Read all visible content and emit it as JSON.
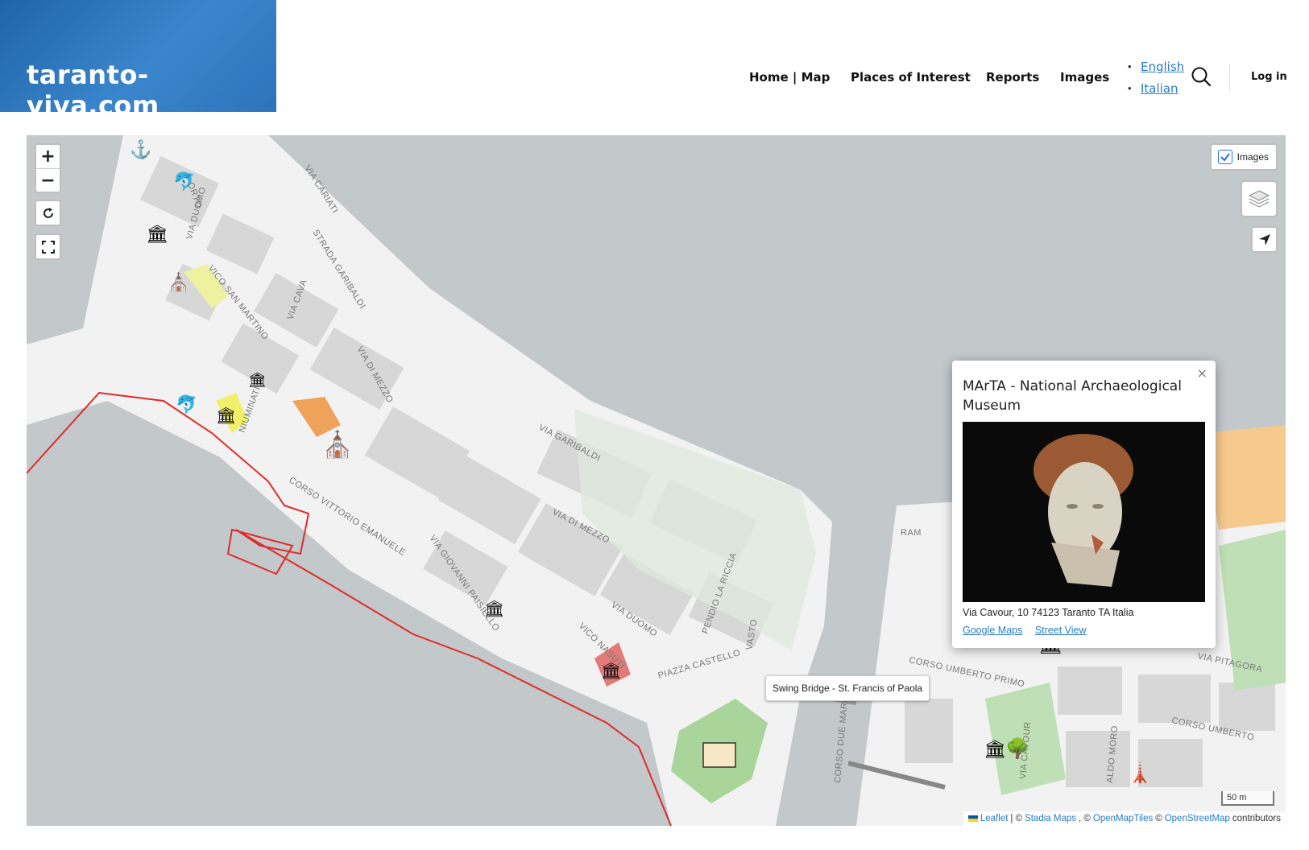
{
  "header": {
    "logo": "taranto-viva.com",
    "nav": [
      "Home | Map",
      "Places of Interest",
      "Reports",
      "Images"
    ],
    "languages": [
      "English",
      "Italian"
    ],
    "login": "Log in"
  },
  "map": {
    "zoom_in": "+",
    "zoom_out": "−",
    "images_toggle": {
      "label": "Images",
      "checked": true
    },
    "popup": {
      "title": "MArTA - National Archaeological Museum",
      "close": "×",
      "address": "Via Cavour, 10 74123 Taranto TA Italia",
      "links": [
        "Google Maps",
        "Street View"
      ]
    },
    "tooltip": "Swing Bridge - St. Francis of Paola",
    "scale": "50 m",
    "attribution": {
      "leaflet": "Leaflet",
      "sep1": "| ©",
      "stadia": "Stadia Maps",
      "sep2": ", ©",
      "omt": "OpenMapTiles",
      "sep3": "©",
      "osm": "OpenStreetMap",
      "tail": "contributors"
    },
    "street_labels": [
      "VIA CARIATI",
      "STRADA GARIBALDI",
      "VICO SAN MARTINO",
      "VIA CAVA",
      "VIA DI MEZZO",
      "VIA DUOMO",
      "ORTO",
      "VIA GARIBALDI",
      "CORSO VITTORIO EMANUELE",
      "VIA GIOVANNI PAISIELLO",
      "VIA DI MEZZO",
      "VIA DUOMO",
      "VICO NASUTI",
      "PIAZZA CASTELLO",
      "PENDIO LA RICCIA",
      "VASTO",
      "CORSO UMBERTO PRIMO",
      "CORSO DUE MARI",
      "VIA CAVOUR",
      "VIA PITAGORA",
      "CORSO UMBERTO",
      "ALDO MORO",
      "RAM",
      "NIUMINATI"
    ]
  }
}
